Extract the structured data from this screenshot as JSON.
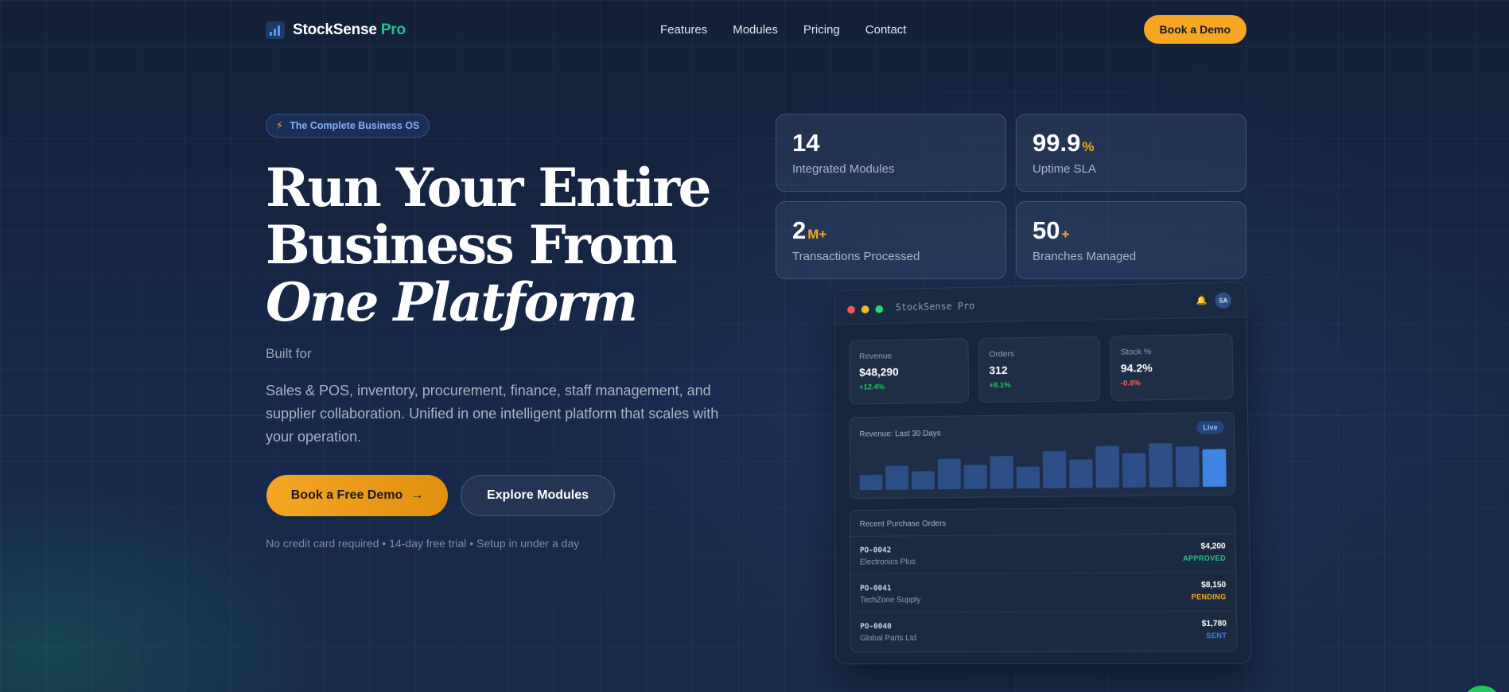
{
  "nav": {
    "brand": "StockSense",
    "brand_accent": "Pro",
    "links": [
      "Features",
      "Modules",
      "Pricing",
      "Contact"
    ],
    "cta": "Book a Demo"
  },
  "hero": {
    "badge": "The Complete Business OS",
    "headline_line1": "Run Your Entire",
    "headline_line2": "Business From",
    "headline_line3": "One Platform",
    "built_for": "Built for",
    "description": "Sales & POS, inventory, procurement, finance, staff management, and supplier collaboration. Unified in one intelligent platform that scales with your operation.",
    "primary_cta": "Book a Free Demo",
    "secondary_cta": "Explore Modules",
    "fine_print": "No credit card required • 14-day free trial • Setup in under a day"
  },
  "stats": [
    {
      "value": "14",
      "suffix": "",
      "label": "Integrated Modules"
    },
    {
      "value": "99.9",
      "suffix": "%",
      "label": "Uptime SLA"
    },
    {
      "value": "2",
      "suffix": "M+",
      "label": "Transactions Processed"
    },
    {
      "value": "50",
      "suffix": "+",
      "label": "Branches Managed"
    }
  ],
  "dashboard": {
    "title": "StockSense Pro",
    "avatar": "SA",
    "kpis": [
      {
        "label": "Revenue",
        "value": "$48,290",
        "change": "+12.4%",
        "trend": "up"
      },
      {
        "label": "Orders",
        "value": "312",
        "change": "+8.1%",
        "trend": "up"
      },
      {
        "label": "Stock %",
        "value": "94.2%",
        "change": "-0.8%",
        "trend": "down"
      }
    ],
    "chart": {
      "title": "Revenue: Last 30 Days",
      "badge": "Live",
      "bar_levels": [
        0.35,
        0.55,
        0.42,
        0.7,
        0.55,
        0.75,
        0.5,
        0.85,
        0.65,
        0.95,
        0.78,
        1.0,
        0.92,
        0.85
      ]
    },
    "orders": {
      "title": "Recent Purchase Orders",
      "rows": [
        {
          "id": "PO-0042",
          "supplier": "Electronics Plus",
          "amount": "$4,200",
          "status": "APPROVED"
        },
        {
          "id": "PO-0041",
          "supplier": "TechZone Supply",
          "amount": "$8,150",
          "status": "PENDING"
        },
        {
          "id": "PO-0040",
          "supplier": "Global Parts Ltd",
          "amount": "$1,780",
          "status": "SENT"
        }
      ]
    }
  },
  "colors": {
    "accent": "#f5a623",
    "brand_green": "#22c48a",
    "up": "#22c55e",
    "down": "#f25f5c",
    "approved": "#22c48a",
    "pending": "#f5a623",
    "sent": "#3b82f6",
    "bar": "#2b4f86",
    "bar_highlight": "#3f84e5"
  }
}
